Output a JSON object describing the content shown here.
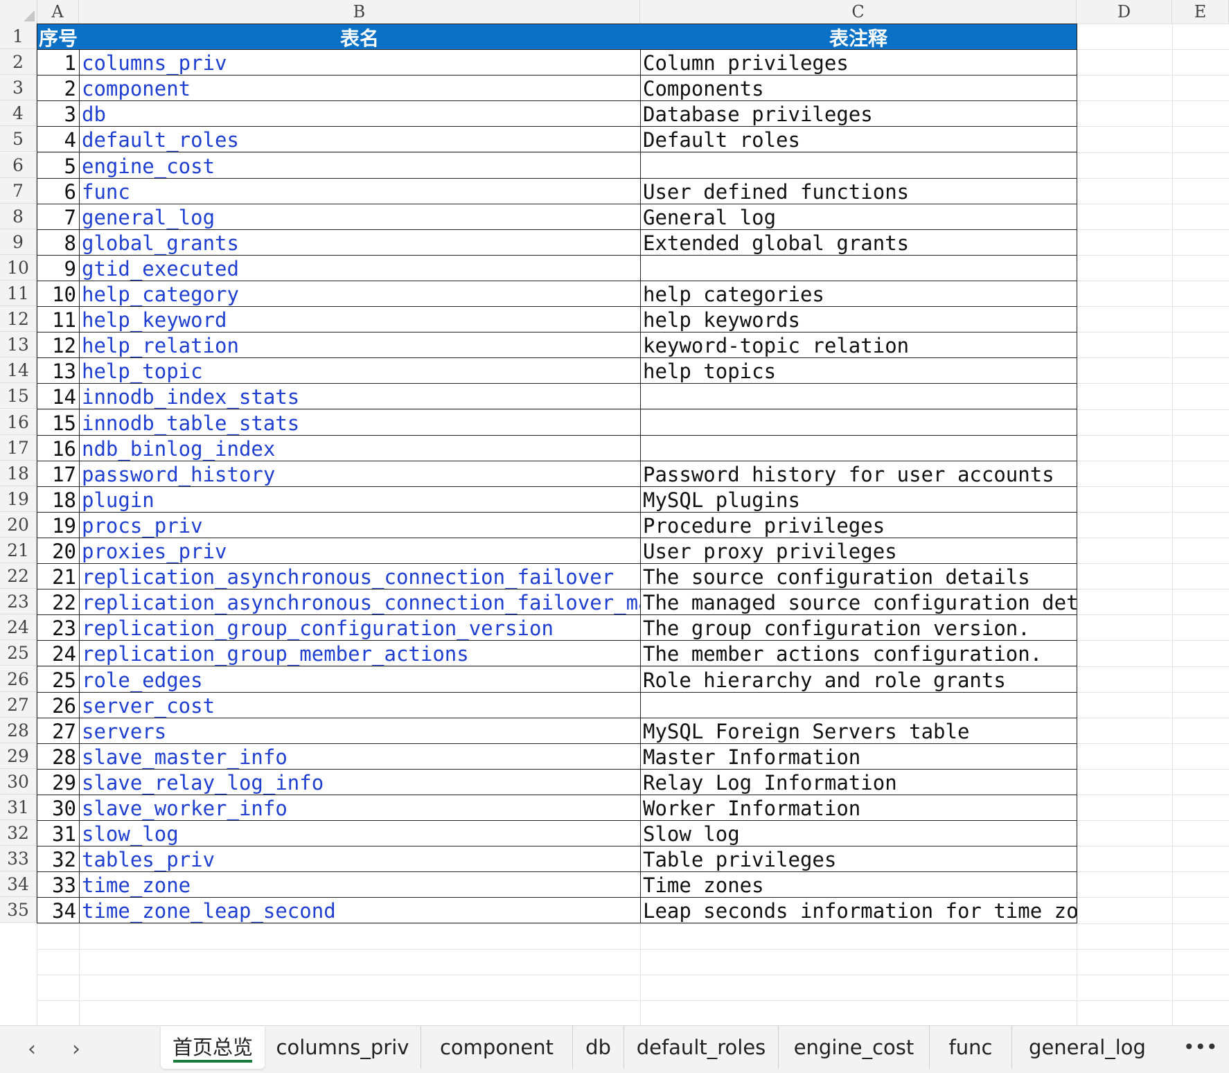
{
  "columns": [
    "A",
    "B",
    "C",
    "D",
    "E"
  ],
  "header": {
    "col_a": "序号",
    "col_b": "表名",
    "col_c": "表注释"
  },
  "rows": [
    {
      "n": "1",
      "name": "columns_priv",
      "desc": "Column privileges"
    },
    {
      "n": "2",
      "name": "component",
      "desc": "Components"
    },
    {
      "n": "3",
      "name": "db",
      "desc": "Database privileges"
    },
    {
      "n": "4",
      "name": "default_roles",
      "desc": "Default roles"
    },
    {
      "n": "5",
      "name": "engine_cost",
      "desc": ""
    },
    {
      "n": "6",
      "name": "func",
      "desc": "User defined functions"
    },
    {
      "n": "7",
      "name": "general_log",
      "desc": "General log"
    },
    {
      "n": "8",
      "name": "global_grants",
      "desc": "Extended global grants"
    },
    {
      "n": "9",
      "name": "gtid_executed",
      "desc": ""
    },
    {
      "n": "10",
      "name": "help_category",
      "desc": "help categories"
    },
    {
      "n": "11",
      "name": "help_keyword",
      "desc": "help keywords"
    },
    {
      "n": "12",
      "name": "help_relation",
      "desc": "keyword-topic relation"
    },
    {
      "n": "13",
      "name": "help_topic",
      "desc": "help topics"
    },
    {
      "n": "14",
      "name": "innodb_index_stats",
      "desc": ""
    },
    {
      "n": "15",
      "name": "innodb_table_stats",
      "desc": ""
    },
    {
      "n": "16",
      "name": "ndb_binlog_index",
      "desc": ""
    },
    {
      "n": "17",
      "name": "password_history",
      "desc": "Password history for user accounts"
    },
    {
      "n": "18",
      "name": "plugin",
      "desc": "MySQL plugins"
    },
    {
      "n": "19",
      "name": "procs_priv",
      "desc": "Procedure privileges"
    },
    {
      "n": "20",
      "name": "proxies_priv",
      "desc": "User proxy privileges"
    },
    {
      "n": "21",
      "name": "replication_asynchronous_connection_failover",
      "desc": "The source configuration details"
    },
    {
      "n": "22",
      "name": "replication_asynchronous_connection_failover_managed",
      "desc": "The managed source configuration details"
    },
    {
      "n": "23",
      "name": "replication_group_configuration_version",
      "desc": "The group configuration version."
    },
    {
      "n": "24",
      "name": "replication_group_member_actions",
      "desc": "The member actions configuration."
    },
    {
      "n": "25",
      "name": "role_edges",
      "desc": "Role hierarchy and role grants"
    },
    {
      "n": "26",
      "name": "server_cost",
      "desc": ""
    },
    {
      "n": "27",
      "name": "servers",
      "desc": "MySQL Foreign Servers table"
    },
    {
      "n": "28",
      "name": "slave_master_info",
      "desc": "Master Information"
    },
    {
      "n": "29",
      "name": "slave_relay_log_info",
      "desc": "Relay Log Information"
    },
    {
      "n": "30",
      "name": "slave_worker_info",
      "desc": "Worker Information"
    },
    {
      "n": "31",
      "name": "slow_log",
      "desc": "Slow log"
    },
    {
      "n": "32",
      "name": "tables_priv",
      "desc": "Table privileges"
    },
    {
      "n": "33",
      "name": "time_zone",
      "desc": "Time zones"
    },
    {
      "n": "34",
      "name": "time_zone_leap_second",
      "desc": "Leap seconds information for time zones"
    }
  ],
  "row_numbers": [
    "1",
    "2",
    "3",
    "4",
    "5",
    "6",
    "7",
    "8",
    "9",
    "10",
    "11",
    "12",
    "13",
    "14",
    "15",
    "16",
    "17",
    "18",
    "19",
    "20",
    "21",
    "22",
    "23",
    "24",
    "25",
    "26",
    "27",
    "28",
    "29",
    "30",
    "31",
    "32",
    "33",
    "34",
    "35"
  ],
  "tabs": [
    "首页总览",
    "columns_priv",
    "component",
    "db",
    "default_roles",
    "engine_cost",
    "func",
    "general_log"
  ],
  "nav": {
    "prev_icon": "chevron-left-icon",
    "next_icon": "chevron-right-icon",
    "prev": "‹",
    "next": "›",
    "more_icon": "more-icon",
    "more": "•••"
  },
  "colors": {
    "header_bg": "#0b71c6",
    "link": "#1f3fd1",
    "active_tab_underline": "#1a7a3c"
  }
}
